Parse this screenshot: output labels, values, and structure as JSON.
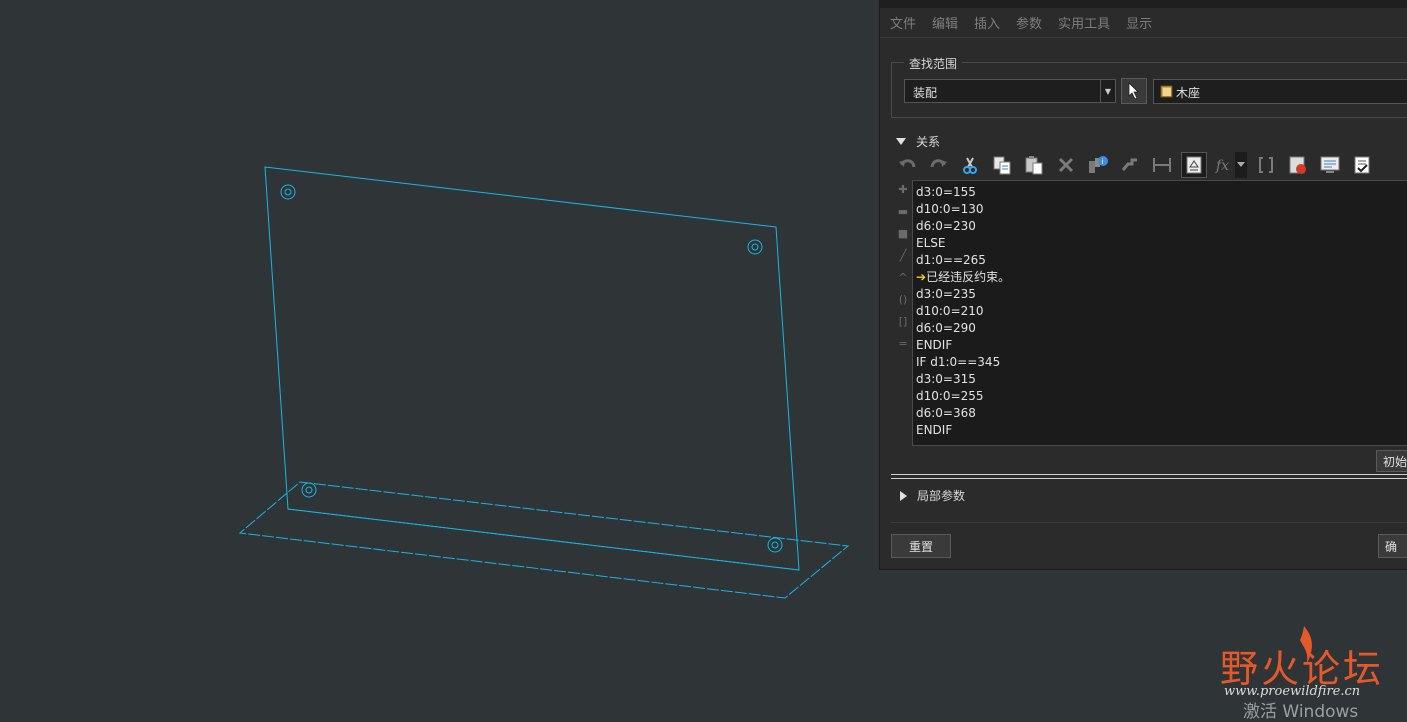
{
  "menu": [
    "文件",
    "编辑",
    "插入",
    "参数",
    "实用工具",
    "显示"
  ],
  "search_scope": {
    "legend": "查找范围",
    "select_value": "装配",
    "model_name": "木座"
  },
  "relations": {
    "section_label": "关系",
    "lines": [
      "d3:0=155",
      "d10:0=130",
      "d6:0=230",
      "ELSE",
      "d1:0==265",
      "已经违反约束。",
      "d3:0=235",
      "d10:0=210",
      "d6:0=290",
      "ENDIF",
      "IF d1:0==345",
      "d3:0=315",
      "d10:0=255",
      "d6:0=368",
      "ENDIF"
    ]
  },
  "buttons": {
    "init": "初始",
    "reset": "重置",
    "ok": "确"
  },
  "local_params": {
    "section_label": "局部参数"
  },
  "watermark": {
    "text": "野火论坛",
    "url": "www.proewildfire.cn"
  },
  "activate_text": "激活 Windows",
  "colors": {
    "model_lines": "#19b5e6",
    "warning": "#f2d21b",
    "watermark": "#e5582a"
  }
}
